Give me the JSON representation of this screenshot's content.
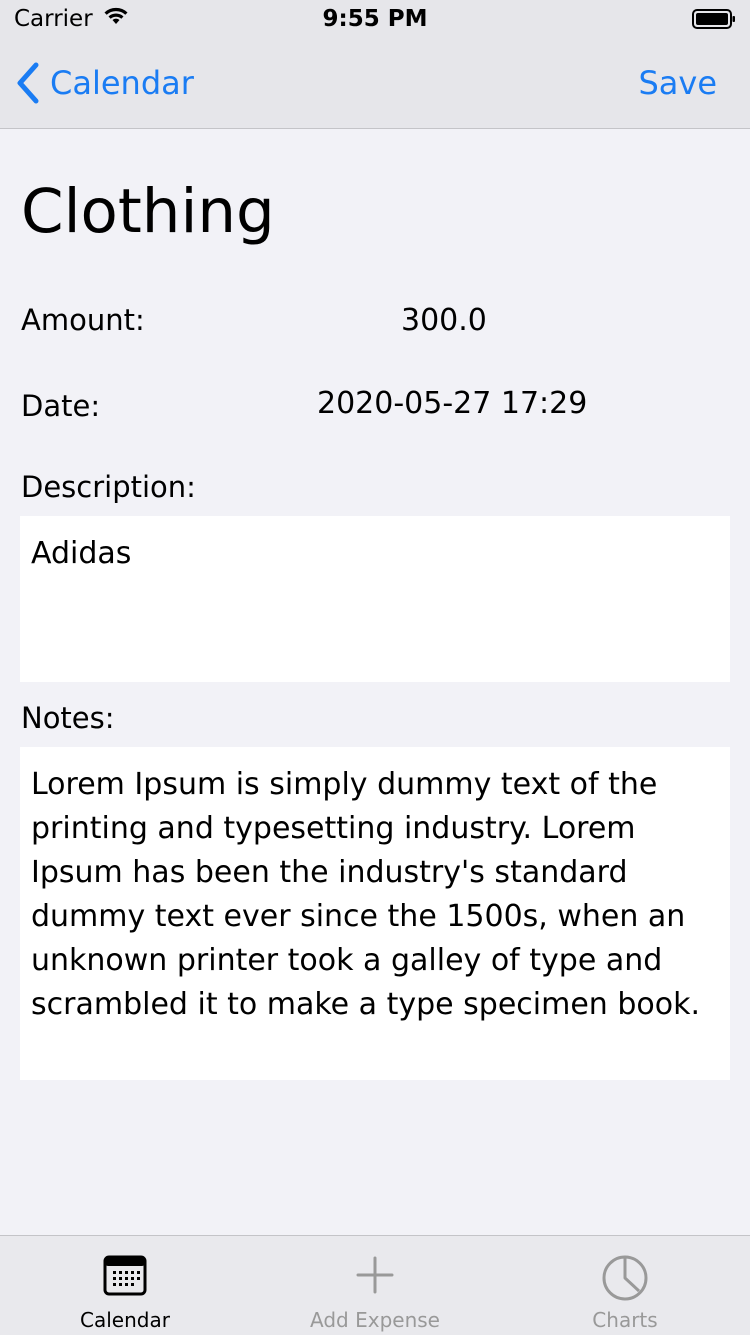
{
  "status_bar": {
    "carrier": "Carrier",
    "time": "9:55 PM"
  },
  "nav": {
    "back_label": "Calendar",
    "save_label": "Save"
  },
  "detail": {
    "title": "Clothing",
    "amount_label": "Amount:",
    "amount_value": "300.0",
    "date_label": "Date:",
    "date_value": "2020-05-27 17:29",
    "description_label": "Description:",
    "description_value": "Adidas",
    "notes_label": "Notes:",
    "notes_value": "Lorem Ipsum is simply dummy text of the printing and typesetting industry. Lorem Ipsum has been the industry's standard dummy text ever since the 1500s, when an unknown printer took a galley of type and scrambled it to make a type specimen book."
  },
  "tabs": [
    {
      "label": "Calendar",
      "icon": "calendar-icon",
      "selected": true
    },
    {
      "label": "Add Expense",
      "icon": "plus-icon",
      "selected": false
    },
    {
      "label": "Charts",
      "icon": "pie-chart-icon",
      "selected": false
    }
  ],
  "colors": {
    "accent": "#1a7cf3",
    "background": "#f2f2f7",
    "bar": "#e6e6ea",
    "tab_selected": "#000000",
    "tab_unselected": "#999999"
  }
}
